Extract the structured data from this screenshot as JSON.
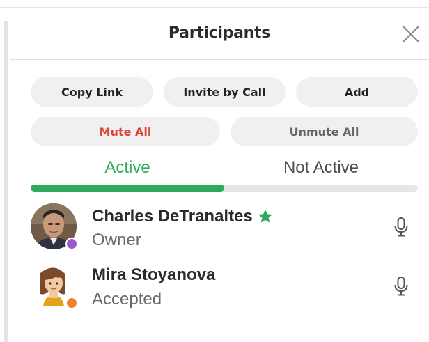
{
  "panel": {
    "title": "Participants",
    "close_icon": "close-icon"
  },
  "actions": {
    "copy_link": "Copy Link",
    "invite_by_call": "Invite by Call",
    "add": "Add",
    "mute_all": "Mute All",
    "unmute_all": "Unmute All"
  },
  "tabs": {
    "active": "Active",
    "not_active": "Not Active",
    "selected": "Active"
  },
  "participants": [
    {
      "name": "Charles DeTranaltes",
      "role": "Owner",
      "badge_icon": "star-icon",
      "status_color": "#9b59c9",
      "mic_icon": "microphone-icon"
    },
    {
      "name": "Mira Stoyanova",
      "role": "Accepted",
      "status_color": "#f0832a",
      "mic_icon": "microphone-icon"
    }
  ],
  "colors": {
    "accent_green": "#2cab5a",
    "danger_red": "#e0423a",
    "pill_bg": "#f0f0f0",
    "track_bg": "#e6e6e6"
  }
}
